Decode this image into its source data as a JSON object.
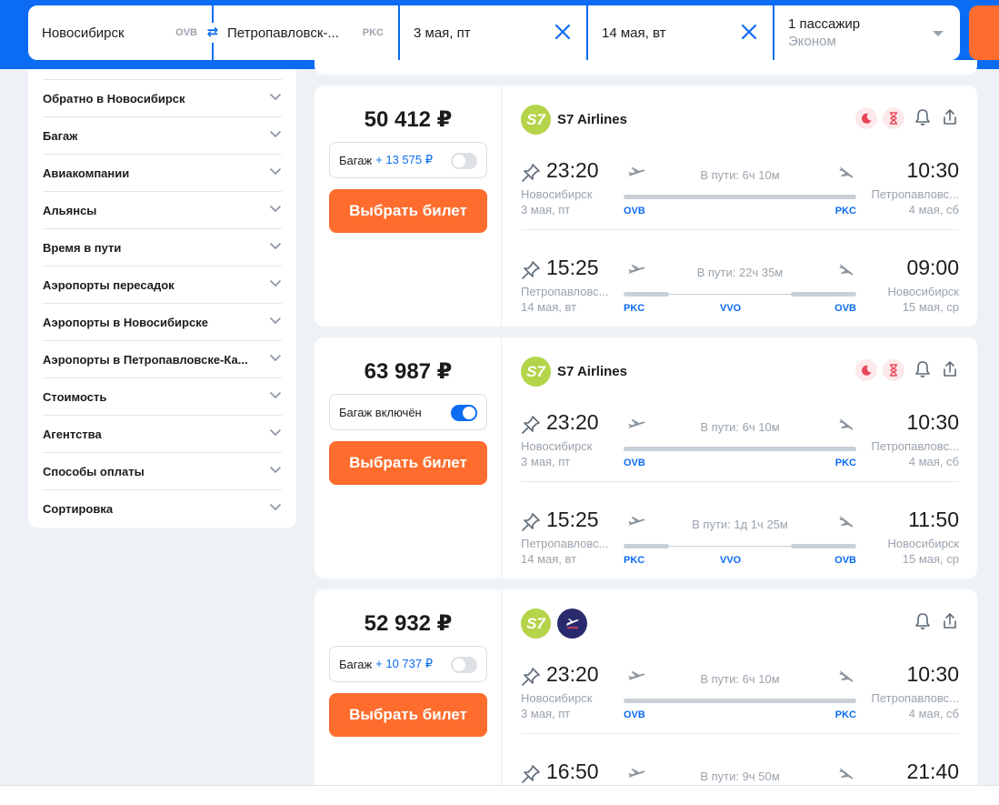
{
  "search": {
    "from_city": "Новосибирск",
    "from_code": "OVB",
    "to_city": "Петропавловск-...",
    "to_code": "PKC",
    "depart_date": "3 мая, пт",
    "return_date": "14 мая, вт",
    "passengers": "1 пассажир",
    "cabin_class": "Эконом"
  },
  "filters": [
    "Обратно в Новосибирск",
    "Багаж",
    "Авиакомпании",
    "Альянсы",
    "Время в пути",
    "Аэропорты пересадок",
    "Аэропорты в Новосибирске",
    "Аэропорты в Петропавловске-Ка...",
    "Стоимость",
    "Агентства",
    "Способы оплаты",
    "Сортировка"
  ],
  "tickets": [
    {
      "price": "50 412 ₽",
      "baggage_label": "Багаж",
      "baggage_add": "+ 13 575 ₽",
      "baggage_included": false,
      "buy_label": "Выбрать билет",
      "airline": "S7 Airlines",
      "outbound": {
        "dep_time": "23:20",
        "dep_city": "Новосибирск",
        "dep_date": "3 мая, пт",
        "dep_code": "OVB",
        "duration": "В пути: 6ч 10м",
        "arr_time": "10:30",
        "arr_city": "Петропавловс...",
        "arr_date": "4 мая, сб",
        "arr_code": "PKC"
      },
      "inbound": {
        "dep_time": "15:25",
        "dep_city": "Петропавловс...",
        "dep_date": "14 мая, вт",
        "dep_code": "PKC",
        "duration": "В пути: 22ч 35м",
        "stop_code": "VVO",
        "arr_time": "09:00",
        "arr_city": "Новосибирск",
        "arr_date": "15 мая, ср",
        "arr_code": "OVB"
      }
    },
    {
      "price": "63 987 ₽",
      "baggage_label": "Багаж включён",
      "baggage_add": "",
      "baggage_included": true,
      "buy_label": "Выбрать билет",
      "airline": "S7 Airlines",
      "outbound": {
        "dep_time": "23:20",
        "dep_city": "Новосибирск",
        "dep_date": "3 мая, пт",
        "dep_code": "OVB",
        "duration": "В пути: 6ч 10м",
        "arr_time": "10:30",
        "arr_city": "Петропавловс...",
        "arr_date": "4 мая, сб",
        "arr_code": "PKC"
      },
      "inbound": {
        "dep_time": "15:25",
        "dep_city": "Петропавловс...",
        "dep_date": "14 мая, вт",
        "dep_code": "PKC",
        "duration": "В пути: 1д 1ч 25м",
        "stop_code": "VVO",
        "arr_time": "11:50",
        "arr_city": "Новосибирск",
        "arr_date": "15 мая, ср",
        "arr_code": "OVB"
      }
    },
    {
      "price": "52 932 ₽",
      "baggage_label": "Багаж",
      "baggage_add": "+ 10 737 ₽",
      "baggage_included": false,
      "buy_label": "Выбрать билет",
      "airline": "",
      "outbound": {
        "dep_time": "23:20",
        "dep_city": "Новосибирск",
        "dep_date": "3 мая, пт",
        "dep_code": "OVB",
        "duration": "В пути: 6ч 10м",
        "arr_time": "10:30",
        "arr_city": "Петропавловс...",
        "arr_date": "4 мая, сб",
        "arr_code": "PKC"
      },
      "inbound": {
        "dep_time": "16:50",
        "duration": "В пути: 9ч 50м",
        "arr_time": "21:40"
      }
    }
  ],
  "icons": {
    "swap": "swap-arrows-icon",
    "clear": "close-icon",
    "dropdown": "chevron-down-icon",
    "night": "moon-icon",
    "short_layover": "hourglass-icon",
    "subscribe": "bell-icon",
    "share": "share-icon",
    "pin": "pin-icon",
    "takeoff": "takeoff-icon",
    "landing": "landing-icon"
  },
  "colors": {
    "brand_blue": "#0b6bf2",
    "accent_orange": "#ff6d2e",
    "s7_green": "#b4d44a"
  }
}
